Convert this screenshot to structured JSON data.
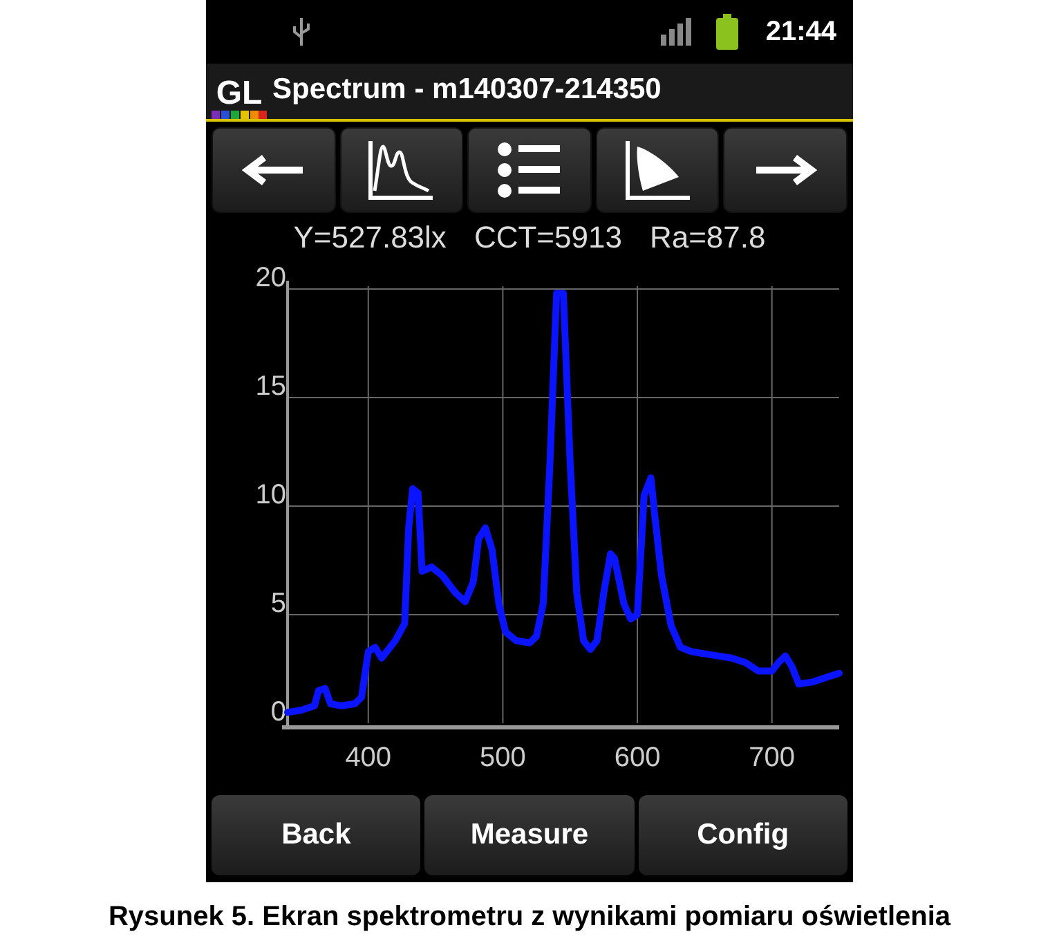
{
  "status_bar": {
    "time": "21:44"
  },
  "title_bar": {
    "logo": "GL",
    "title": "Spectrum - m140307-214350"
  },
  "toolbar": [
    {
      "kind": "left"
    },
    {
      "kind": "spectrum"
    },
    {
      "kind": "list"
    },
    {
      "kind": "chromaticity"
    },
    {
      "kind": "right"
    }
  ],
  "readings": [
    "Y=527.83lx",
    "CCT=5913",
    "Ra=87.8"
  ],
  "chart_data": {
    "type": "line",
    "x": [
      340,
      350,
      360,
      363,
      368,
      372,
      380,
      390,
      395,
      400,
      405,
      410,
      420,
      427,
      430,
      433,
      437,
      440,
      447,
      455,
      465,
      472,
      478,
      482,
      487,
      492,
      497,
      502,
      510,
      520,
      525,
      530,
      535,
      540,
      545,
      550,
      555,
      560,
      565,
      570,
      575,
      580,
      583,
      590,
      595,
      600,
      605,
      610,
      613,
      618,
      625,
      632,
      640,
      650,
      660,
      670,
      680,
      690,
      700,
      705,
      710,
      715,
      720,
      730,
      740,
      750
    ],
    "grid": true,
    "series": [
      {
        "color": "#0a14ff",
        "values": [
          0.5,
          0.6,
          0.8,
          1.5,
          1.6,
          0.9,
          0.8,
          0.9,
          1.2,
          3.3,
          3.5,
          3.0,
          3.8,
          4.6,
          9,
          10.8,
          10.6,
          7.0,
          7.2,
          6.8,
          6.0,
          5.6,
          6.5,
          8.5,
          9.0,
          8.0,
          5.5,
          4.2,
          3.8,
          3.7,
          4.0,
          5.5,
          12,
          19.8,
          19.8,
          12,
          6,
          3.8,
          3.4,
          3.8,
          6,
          7.8,
          7.6,
          5.5,
          4.8,
          5,
          10.5,
          11.3,
          9.5,
          6.8,
          4.5,
          3.5,
          3.3,
          3.2,
          3.1,
          3.0,
          2.8,
          2.4,
          2.4,
          2.8,
          3.1,
          2.6,
          1.8,
          1.9,
          2.1,
          2.3
        ]
      }
    ],
    "xlim": [
      340,
      750
    ],
    "ylim": [
      0,
      20
    ],
    "xticks": [
      400,
      500,
      600,
      700
    ],
    "yticks": [
      0,
      5,
      10,
      15,
      20
    ]
  },
  "buttons": [
    "Back",
    "Measure",
    "Config"
  ],
  "caption": "Rysunek 5. Ekran spektrometru z wynikami pomiaru oświetlenia"
}
